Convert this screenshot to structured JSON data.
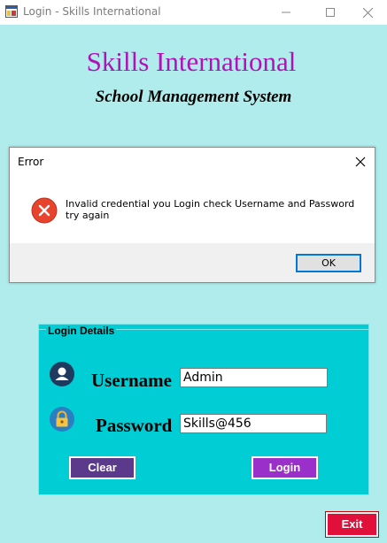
{
  "window": {
    "title": "Login - Skills International"
  },
  "app": {
    "title": "Skills International",
    "subtitle": "School Management System",
    "title_color": "#b012b8",
    "background_color": "#b0ecec"
  },
  "dialog": {
    "title": "Error",
    "message": "Invalid credential you Login check Username and Password try again",
    "ok_label": "OK",
    "icon": "error-icon"
  },
  "login": {
    "group_label": "Login Details",
    "username_label": "Username",
    "password_label": "Password",
    "username_value": "Admin",
    "password_value": "Skills@456",
    "clear_label": "Clear",
    "login_label": "Login",
    "exit_label": "Exit",
    "group_color": "#00cdd4",
    "user_icon": "user-icon",
    "lock_icon": "lock-icon"
  }
}
